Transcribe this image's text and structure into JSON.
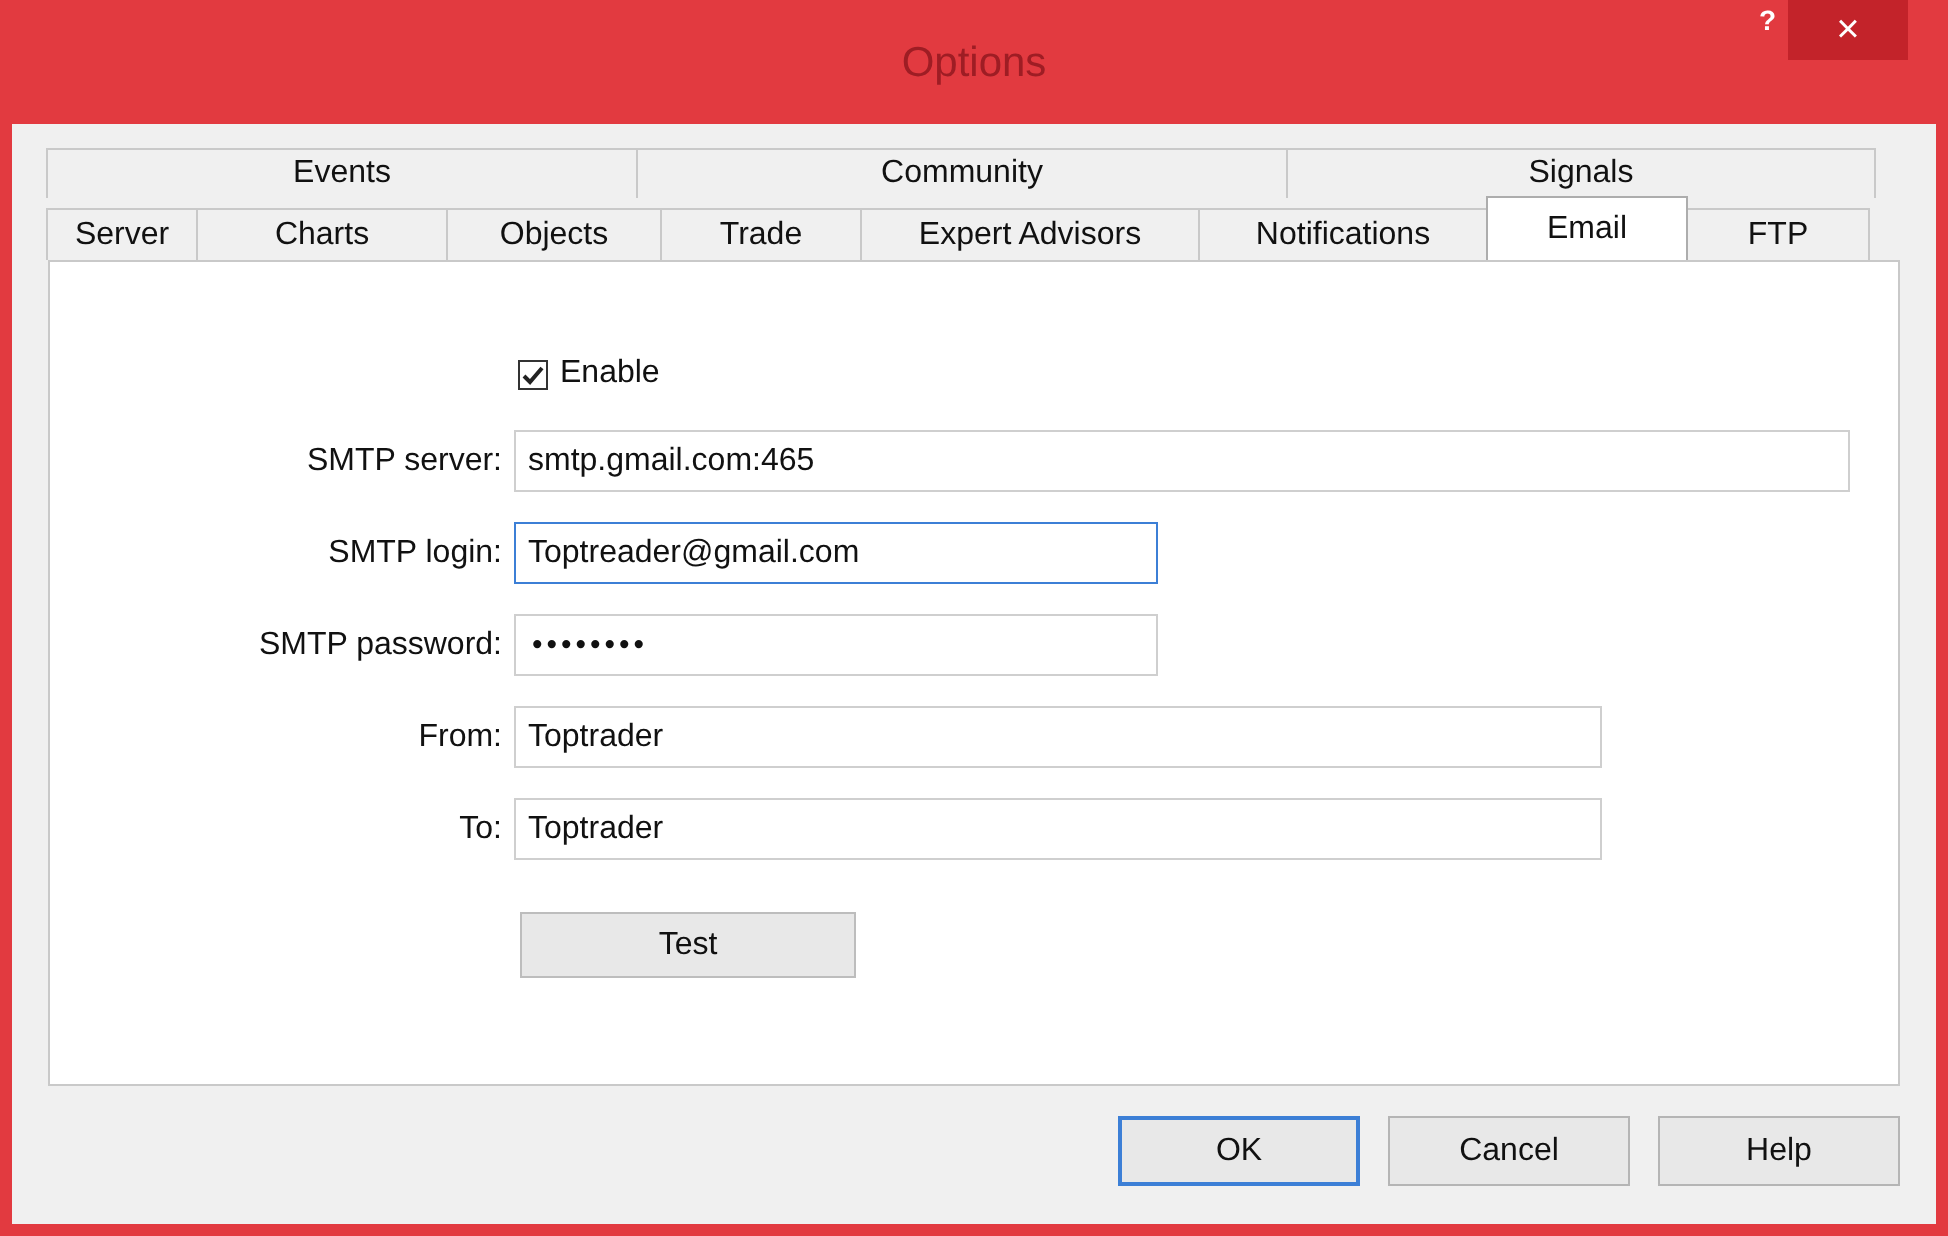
{
  "window": {
    "title": "Options",
    "help_button": "?",
    "close_button": "×"
  },
  "tab_rows": [
    [
      {
        "label": "Events",
        "selected": false
      },
      {
        "label": "Community",
        "selected": false
      },
      {
        "label": "Signals",
        "selected": false
      }
    ],
    [
      {
        "label": "Server",
        "selected": false
      },
      {
        "label": "Charts",
        "selected": false
      },
      {
        "label": "Objects",
        "selected": false
      },
      {
        "label": "Trade",
        "selected": false
      },
      {
        "label": "Expert Advisors",
        "selected": false
      },
      {
        "label": "Notifications",
        "selected": false
      },
      {
        "label": "Email",
        "selected": true
      },
      {
        "label": "FTP",
        "selected": false
      }
    ]
  ],
  "enable": {
    "label": "Enable",
    "checked": true
  },
  "fields": [
    {
      "kind": "text",
      "label": "SMTP server:",
      "value": "smtp.gmail.com:465",
      "focused": false
    },
    {
      "kind": "text",
      "label": "SMTP login:",
      "value": "Toptreader@gmail.com",
      "focused": true
    },
    {
      "kind": "password",
      "label": "SMTP password:",
      "value": "••••••••",
      "focused": false
    },
    {
      "kind": "text",
      "label": "From:",
      "value": "Toptrader",
      "focused": false
    },
    {
      "kind": "text",
      "label": "To:",
      "value": "Toptrader",
      "focused": false
    }
  ],
  "test_button": "Test",
  "buttons": [
    {
      "label": "OK",
      "default": true
    },
    {
      "label": "Cancel",
      "default": false
    },
    {
      "label": "Help",
      "default": false
    }
  ]
}
